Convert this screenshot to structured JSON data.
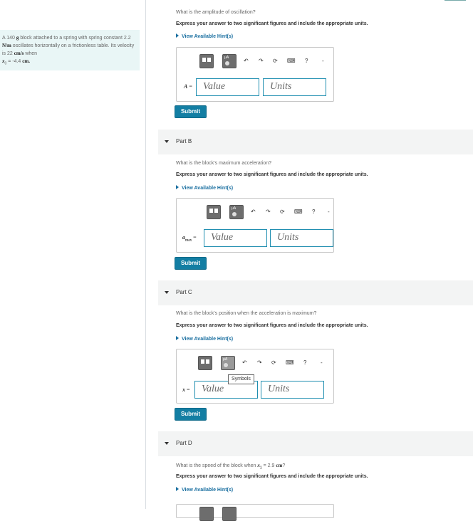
{
  "problem": {
    "text_1": "A 140",
    "unit_g": "g",
    "text_2": "block attached to a spring with spring constant 2.2",
    "unit_Nm": "N/m",
    "text_3": "oscillates horizontally on a frictionless table. Its velocity is 22",
    "unit_cms": "cm/s",
    "text_4": "when",
    "var_x0": "x",
    "sub_0": "0",
    "text_5": " = -4.4",
    "unit_cm": "cm."
  },
  "instructions": "Express your answer to two significant figures and include the appropriate units.",
  "hint_label": "View Available Hint(s)",
  "submit_label": "Submit",
  "placeholders": {
    "value": "Value",
    "units": "Units"
  },
  "toolbar": {
    "button_label": "μA",
    "help": "?",
    "tooltip": "Symbols"
  },
  "parts": {
    "a": {
      "question": "What is the amplitude of oscillation?",
      "var": "A",
      "eq": " ="
    },
    "b": {
      "title": "Part B",
      "question": "What is the block's maximum acceleration?",
      "var": "a",
      "sub": "max",
      "eq": " ="
    },
    "c": {
      "title": "Part C",
      "question": "What is the block's position when the acceleration is maximum?",
      "var": "x",
      "eq": " ="
    },
    "d": {
      "title": "Part D",
      "question_1": "What is the speed of the block when",
      "var": "x",
      "sub": "1",
      "question_2": " = 2.9",
      "unit": "cm",
      "question_3": "?"
    }
  }
}
